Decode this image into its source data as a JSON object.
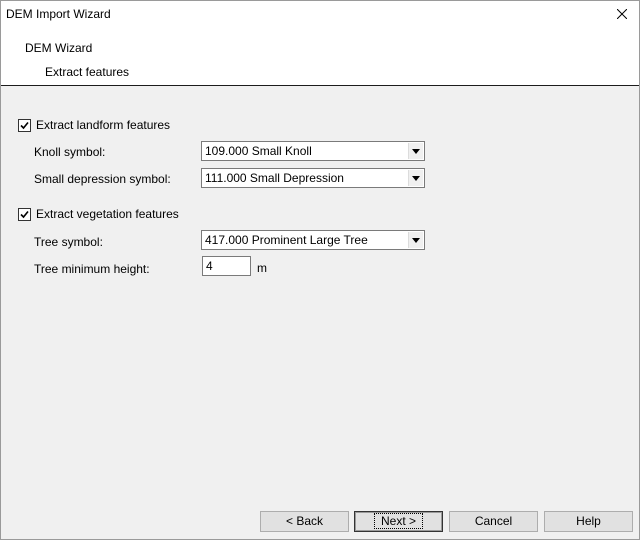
{
  "window": {
    "title": "DEM Import Wizard"
  },
  "header": {
    "title": "DEM Wizard",
    "subtitle": "Extract features"
  },
  "landform": {
    "checkbox_label": "Extract landform features",
    "checked": true,
    "knoll_label": "Knoll symbol:",
    "knoll_value": "109.000 Small Knoll",
    "depression_label": "Small depression symbol:",
    "depression_value": "111.000 Small Depression"
  },
  "vegetation": {
    "checkbox_label": "Extract vegetation features",
    "checked": true,
    "tree_label": "Tree symbol:",
    "tree_value": "417.000 Prominent Large Tree",
    "min_height_label": "Tree minimum height:",
    "min_height_value": "4",
    "min_height_unit": "m"
  },
  "buttons": {
    "back": "< Back",
    "next": "Next >",
    "cancel": "Cancel",
    "help": "Help"
  },
  "icons": {
    "close": "close-icon",
    "check": "checkmark-icon",
    "dropdown": "chevron-down-icon"
  }
}
